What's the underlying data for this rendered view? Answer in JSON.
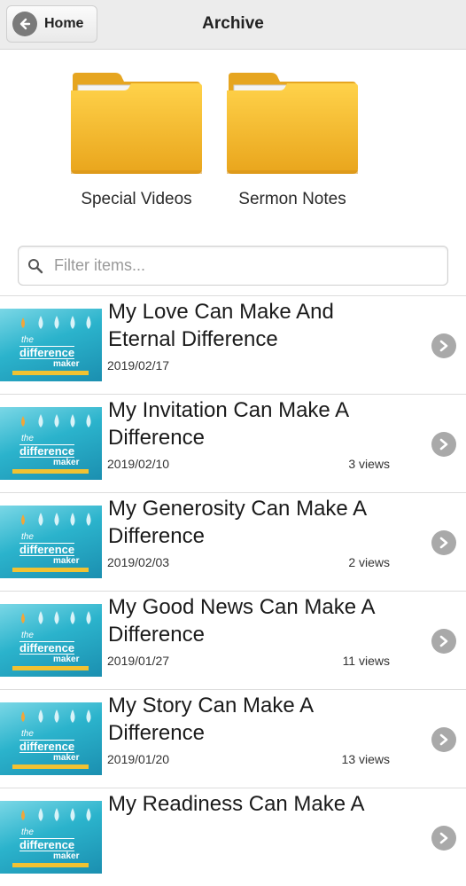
{
  "header": {
    "home_label": "Home",
    "title": "Archive"
  },
  "folders": [
    {
      "label": "Special Videos"
    },
    {
      "label": "Sermon Notes"
    }
  ],
  "filter": {
    "placeholder": "Filter items..."
  },
  "thumbnail": {
    "line1": "the",
    "line2": "difference",
    "line3": "maker"
  },
  "items": [
    {
      "title": "My Love Can Make And Eternal Difference",
      "date": "2019/02/17",
      "views": ""
    },
    {
      "title": "My Invitation Can Make A Difference",
      "date": "2019/02/10",
      "views": "3 views"
    },
    {
      "title": "My Generosity Can Make A Difference",
      "date": "2019/02/03",
      "views": "2 views"
    },
    {
      "title": "My Good News Can Make A Difference",
      "date": "2019/01/27",
      "views": "11 views"
    },
    {
      "title": "My Story Can Make A Difference",
      "date": "2019/01/20",
      "views": "13 views"
    },
    {
      "title": "My Readiness Can Make A",
      "date": "",
      "views": ""
    }
  ],
  "colors": {
    "folder": "#f5b82a",
    "header_bg": "#ececec",
    "chevron": "#a9a9a9"
  }
}
